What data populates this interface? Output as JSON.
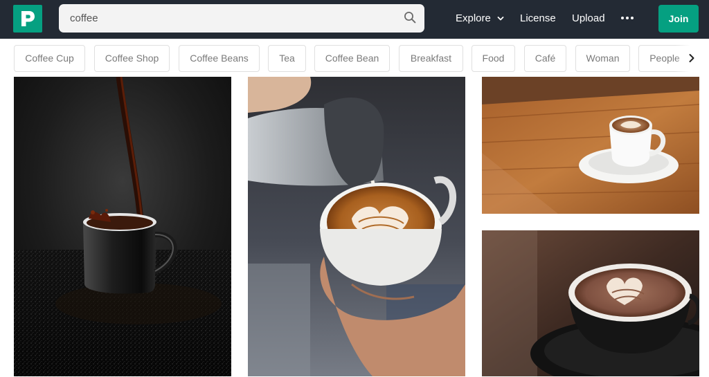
{
  "header": {
    "logo_icon": "pexels-logo-icon",
    "brand_color": "#05a081",
    "search": {
      "value": "coffee",
      "icon": "search-icon"
    },
    "nav": {
      "explore": "Explore",
      "license": "License",
      "upload": "Upload",
      "more_icon": "more-dots-icon"
    },
    "join_label": "Join"
  },
  "tags": {
    "items": [
      "Coffee Cup",
      "Coffee Shop",
      "Coffee Beans",
      "Tea",
      "Coffee Bean",
      "Breakfast",
      "Food",
      "Café",
      "Woman",
      "People"
    ],
    "next_icon": "chevron-right-icon"
  },
  "photos": [
    {
      "subject": "coffee being poured into a black cup",
      "column": 1
    },
    {
      "subject": "latte art being poured into a white cup",
      "column": 2
    },
    {
      "subject": "white coffee cup on a wooden table",
      "column": 3
    },
    {
      "subject": "cappuccino with heart latte art in a dark cup",
      "column": 3
    }
  ]
}
